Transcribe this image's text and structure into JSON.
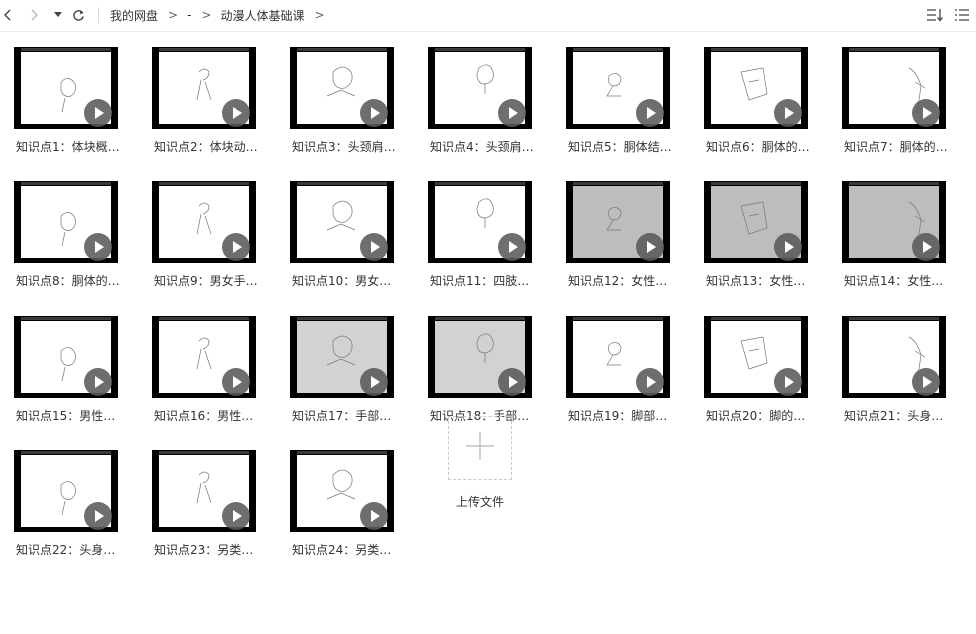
{
  "toolbar": {
    "breadcrumb": [
      "我的网盘",
      "-",
      "动漫人体基础课"
    ]
  },
  "files": [
    {
      "name": "知识点1：体块概…",
      "style": "white"
    },
    {
      "name": "知识点2：体块动…",
      "style": "white"
    },
    {
      "name": "知识点3：头颈肩…",
      "style": "white"
    },
    {
      "name": "知识点4：头颈肩…",
      "style": "white"
    },
    {
      "name": "知识点5：胴体结…",
      "style": "white"
    },
    {
      "name": "知识点6：胴体的…",
      "style": "white"
    },
    {
      "name": "知识点7：胴体的…",
      "style": "white"
    },
    {
      "name": "知识点8：胴体的…",
      "style": "white"
    },
    {
      "name": "知识点9：男女手…",
      "style": "white"
    },
    {
      "name": "知识点10：男女…",
      "style": "white"
    },
    {
      "name": "知识点11：四肢…",
      "style": "white"
    },
    {
      "name": "知识点12：女性…",
      "style": "gray"
    },
    {
      "name": "知识点13：女性…",
      "style": "gray"
    },
    {
      "name": "知识点14：女性…",
      "style": "gray"
    },
    {
      "name": "知识点15：男性…",
      "style": "white"
    },
    {
      "name": "知识点16：男性…",
      "style": "white"
    },
    {
      "name": "知识点17：手部…",
      "style": "grayL"
    },
    {
      "name": "知识点18：手部…",
      "style": "grayL"
    },
    {
      "name": "知识点19：脚部…",
      "style": "white"
    },
    {
      "name": "知识点20：脚的…",
      "style": "white"
    },
    {
      "name": "知识点21：头身…",
      "style": "white"
    },
    {
      "name": "知识点22：头身…",
      "style": "white"
    },
    {
      "name": "知识点23：另类…",
      "style": "white"
    },
    {
      "name": "知识点24：另类…",
      "style": "white"
    }
  ],
  "upload": {
    "label": "上传文件"
  }
}
